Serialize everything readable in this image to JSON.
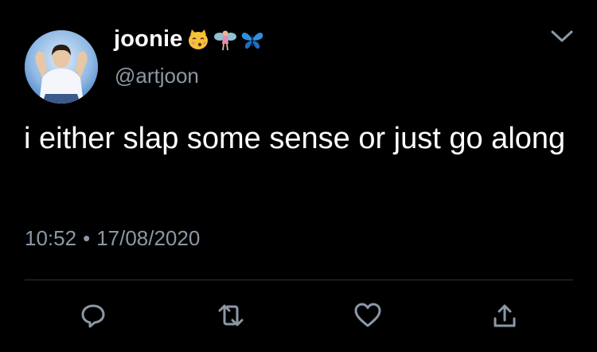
{
  "tweet": {
    "display_name": "joonie",
    "name_emojis": [
      "kissing-cat-emoji",
      "fairy-emoji",
      "butterfly-emoji"
    ],
    "handle": "@artjoon",
    "text": "i either slap some sense or just go along",
    "time": "10:52",
    "date": "17/08/2020",
    "separator": "•"
  },
  "actions": {
    "icons": [
      "reply-icon",
      "retweet-icon",
      "like-icon",
      "share-icon"
    ]
  },
  "colors": {
    "background": "#000000",
    "primary_text": "#ffffff",
    "secondary_text": "#8b98a5",
    "divider": "#2f3336",
    "icon": "#8b98a5"
  }
}
